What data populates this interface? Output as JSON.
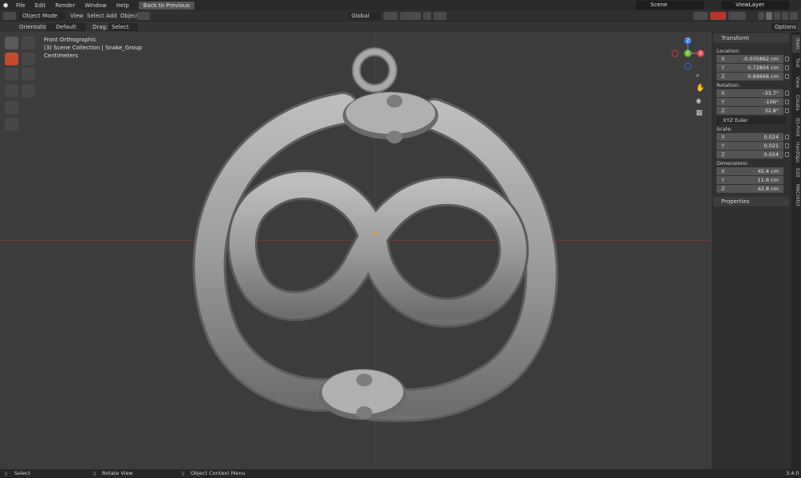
{
  "menu": {
    "items": [
      "File",
      "Edit",
      "Render",
      "Window",
      "Help"
    ],
    "back_button": "Back to Previous",
    "scene": "Scene",
    "view_layer": "ViewLayer"
  },
  "header": {
    "mode": "Object Mode",
    "menus": [
      "View",
      "Select",
      "Add",
      "Object"
    ],
    "transform_orientation": "Global"
  },
  "tool_settings": {
    "orientation_label": "Orientation:",
    "orientation_value": "Default",
    "drag_label": "Drag:",
    "drag_value": "Select Box",
    "options": "Options"
  },
  "viewport": {
    "view_name": "Front Orthographic",
    "collection": "(3) Scene Collection | Snake_Group",
    "units": "Centimeters",
    "gizmo_labels": {
      "z": "Z",
      "x": "X",
      "y": "Y"
    }
  },
  "sidebar": {
    "transform_header": "Transform",
    "location_label": "Location:",
    "location": [
      {
        "axis": "X",
        "value": "-0.035862 cm"
      },
      {
        "axis": "Y",
        "value": "0.72804 cm"
      },
      {
        "axis": "Z",
        "value": "0.69666 cm"
      }
    ],
    "rotation_label": "Rotation:",
    "rotation": [
      {
        "axis": "X",
        "value": "-33.7°"
      },
      {
        "axis": "Y",
        "value": "-106°"
      },
      {
        "axis": "Z",
        "value": "32.8°"
      }
    ],
    "rotation_mode": "XYZ Euler",
    "scale_label": "Scale:",
    "scale": [
      {
        "axis": "X",
        "value": "0.024"
      },
      {
        "axis": "Y",
        "value": "0.021"
      },
      {
        "axis": "Z",
        "value": "0.024"
      }
    ],
    "dimensions_label": "Dimensions:",
    "dimensions": [
      {
        "axis": "X",
        "value": "45.4 cm"
      },
      {
        "axis": "Y",
        "value": "11.6 cm"
      },
      {
        "axis": "Z",
        "value": "42.8 cm"
      }
    ],
    "properties_header": "Properties",
    "tabs": [
      "Item",
      "Tool",
      "View",
      "Create",
      "3D-Print",
      "HardOps",
      "Edit",
      "MACHIN3"
    ]
  },
  "statusbar": {
    "select": "Select",
    "rotate": "Rotate View",
    "context": "Object Context Menu",
    "version": "3.4.0"
  },
  "colors": {
    "accent": "#c9492c",
    "axis_x": "#e04a4a",
    "axis_y": "#6bbf3a",
    "axis_z": "#3d7fe0"
  }
}
